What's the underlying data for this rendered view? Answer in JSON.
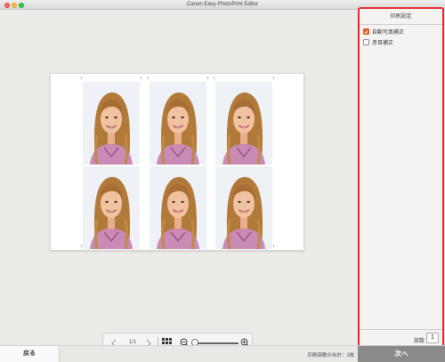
{
  "window": {
    "title": "Canon Easy-PhotoPrint Editor"
  },
  "preview": {
    "page_indicator": "1/1",
    "photos": [
      {
        "icon": "id-photo-portrait"
      },
      {
        "icon": "id-photo-portrait"
      },
      {
        "icon": "id-photo-portrait"
      },
      {
        "icon": "id-photo-portrait"
      },
      {
        "icon": "id-photo-portrait"
      },
      {
        "icon": "id-photo-portrait"
      }
    ]
  },
  "toolbar": {
    "prev_icon": "chevron-left-icon",
    "next_icon": "chevron-right-icon",
    "grid_icon": "grid-icon",
    "zoom_out_icon": "zoom-out-icon",
    "zoom_in_icon": "zoom-in-icon",
    "zoom_level": 0.0
  },
  "panel": {
    "title": "印刷設定",
    "options": [
      {
        "label": "自動写真補正",
        "checked": true
      },
      {
        "label": "赤目補正",
        "checked": false
      }
    ],
    "copies_label": "部数",
    "copies_value": "1"
  },
  "footer": {
    "back_label": "戻る",
    "total_label": "印刷部数の合計：1枚",
    "next_label": "次へ"
  },
  "colors": {
    "accent": "#e8262b",
    "checkbox_checked": "#e8632a",
    "next_button": "#8a8a8a"
  }
}
